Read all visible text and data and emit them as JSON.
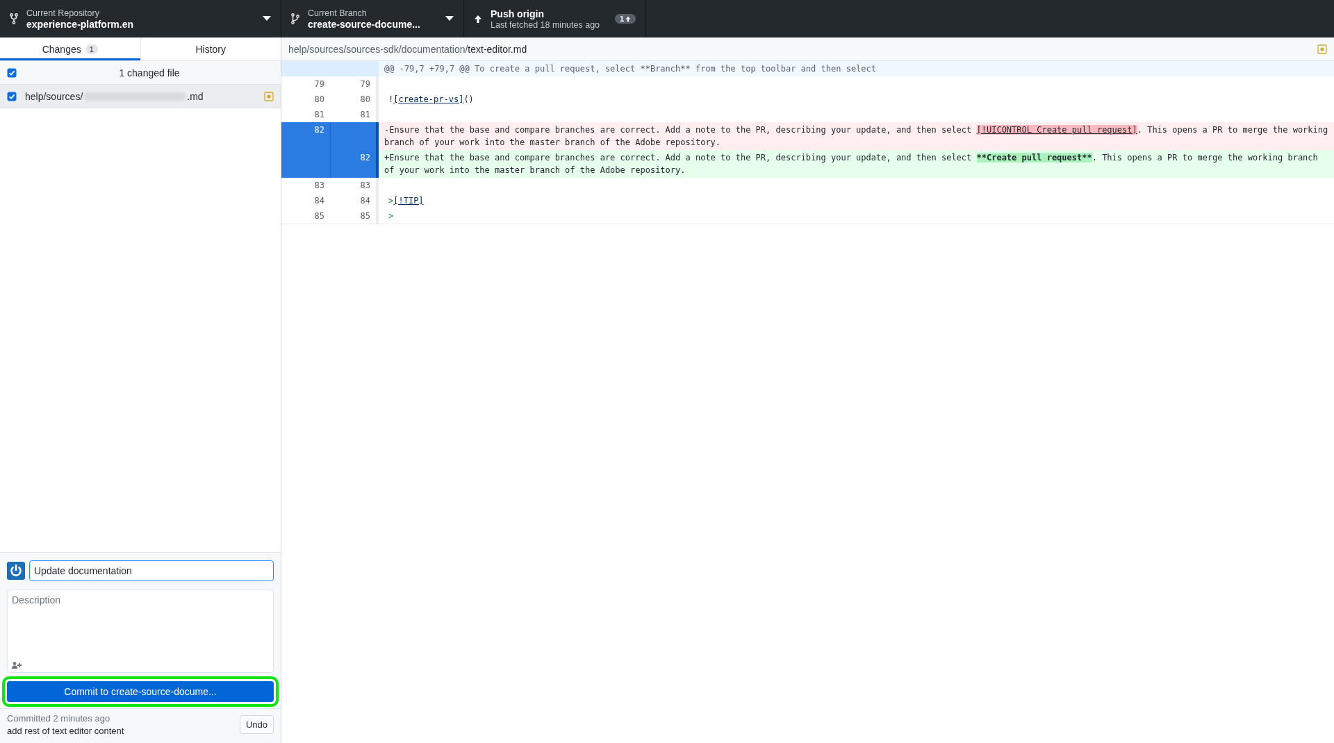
{
  "toolbar": {
    "repository": {
      "label": "Current Repository",
      "value": "experience-platform.en"
    },
    "branch": {
      "label": "Current Branch",
      "value": "create-source-docume..."
    },
    "push": {
      "title": "Push origin",
      "subtitle": "Last fetched 18 minutes ago",
      "badge": "1"
    }
  },
  "sidebar": {
    "tabs": [
      {
        "label": "Changes",
        "count": "1",
        "selected": true
      },
      {
        "label": "History",
        "selected": false
      }
    ],
    "changes": {
      "all_checked": true,
      "summary": "1 changed file",
      "files": [
        {
          "checked": true,
          "selected": true,
          "path_start": "help/sources/",
          "path_end": ".md",
          "modified": true
        }
      ]
    },
    "commit": {
      "summary": "Update documentation",
      "description_placeholder": "Description",
      "button": "Commit to create-source-docume...",
      "highlighted": true
    },
    "last_commit": {
      "label": "Committed 2 minutes ago",
      "message": "add rest of text editor content",
      "undo": "Undo"
    }
  },
  "diff": {
    "path_dir": "help/sources/sources-sdk/documentation/",
    "path_file": "text-editor.md",
    "modified": true,
    "lines": [
      {
        "kind": "hunk",
        "selected": false,
        "segments": [
          {
            "kind": "plain",
            "text": "@@ -79,7 +79,7 @@ To create a pull request, select **Branch** from the top toolbar and then select"
          }
        ]
      },
      {
        "kind": "context",
        "selected": false,
        "old": "79",
        "new": "79"
      },
      {
        "kind": "context",
        "selected": false,
        "old": "80",
        "new": "80",
        "segments": [
          {
            "kind": "plain",
            "text": "!"
          },
          {
            "kind": "link",
            "text": "[create-pr-vs]"
          },
          {
            "kind": "plain",
            "text": "()"
          }
        ]
      },
      {
        "kind": "context",
        "selected": false,
        "old": "81",
        "new": "81"
      },
      {
        "kind": "deleted",
        "selected": true,
        "old": "82",
        "segments": [
          {
            "kind": "plain",
            "text": "-Ensure that the base and compare branches are correct. Add a note to the PR, describing your update, and then select "
          },
          {
            "kind": "removed",
            "text": "[!UICONTROL Create pull request]"
          },
          {
            "kind": "plain",
            "text": ". This opens a PR to merge the working branch of your work into the master branch of the Adobe repository."
          }
        ]
      },
      {
        "kind": "added",
        "selected": true,
        "new": "82",
        "segments": [
          {
            "kind": "plain",
            "text": "+Ensure that the base and compare branches are correct. Add a note to the PR, describing your update, and then select "
          },
          {
            "kind": "inserted",
            "text": "**Create pull request**"
          },
          {
            "kind": "plain",
            "text": ". This opens a PR to merge the working branch of your work into the master branch of the Adobe repository."
          }
        ]
      },
      {
        "kind": "context",
        "selected": false,
        "old": "83",
        "new": "83"
      },
      {
        "kind": "context",
        "selected": false,
        "old": "84",
        "new": "84",
        "segments": [
          {
            "kind": "quote",
            "text": ">"
          },
          {
            "kind": "link",
            "text": "[!TIP]"
          }
        ]
      },
      {
        "kind": "context",
        "selected": false,
        "old": "85",
        "new": "85",
        "segments": [
          {
            "kind": "quote",
            "text": ">"
          }
        ]
      }
    ]
  }
}
